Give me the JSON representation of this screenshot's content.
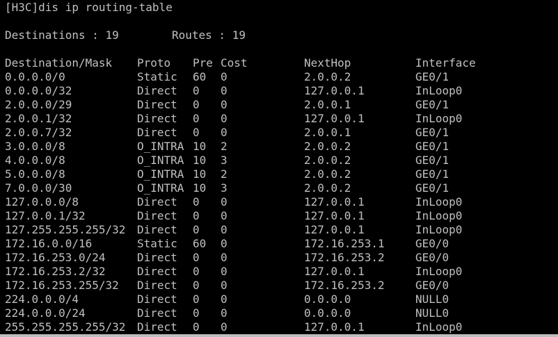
{
  "terminal": {
    "command_line": "[H3C]dis ip routing-table",
    "summary": {
      "destinations": "Destinations : 19",
      "routes": "Routes : 19"
    },
    "headers": {
      "destination": "Destination/Mask",
      "proto": "Proto",
      "pre": "Pre",
      "cost": "Cost",
      "nexthop": "NextHop",
      "interface": "Interface"
    },
    "rows": [
      {
        "dest": "0.0.0.0/0",
        "proto": "Static",
        "pre": "60",
        "cost": "0",
        "nexthop": "2.0.0.2",
        "iface": "GE0/1"
      },
      {
        "dest": "0.0.0.0/32",
        "proto": "Direct",
        "pre": "0",
        "cost": "0",
        "nexthop": "127.0.0.1",
        "iface": "InLoop0"
      },
      {
        "dest": "2.0.0.0/29",
        "proto": "Direct",
        "pre": "0",
        "cost": "0",
        "nexthop": "2.0.0.1",
        "iface": "GE0/1"
      },
      {
        "dest": "2.0.0.1/32",
        "proto": "Direct",
        "pre": "0",
        "cost": "0",
        "nexthop": "127.0.0.1",
        "iface": "InLoop0"
      },
      {
        "dest": "2.0.0.7/32",
        "proto": "Direct",
        "pre": "0",
        "cost": "0",
        "nexthop": "2.0.0.1",
        "iface": "GE0/1"
      },
      {
        "dest": "3.0.0.0/8",
        "proto": "O_INTRA",
        "pre": "10",
        "cost": "2",
        "nexthop": "2.0.0.2",
        "iface": "GE0/1"
      },
      {
        "dest": "4.0.0.0/8",
        "proto": "O_INTRA",
        "pre": "10",
        "cost": "3",
        "nexthop": "2.0.0.2",
        "iface": "GE0/1"
      },
      {
        "dest": "5.0.0.0/8",
        "proto": "O_INTRA",
        "pre": "10",
        "cost": "2",
        "nexthop": "2.0.0.2",
        "iface": "GE0/1"
      },
      {
        "dest": "7.0.0.0/30",
        "proto": "O_INTRA",
        "pre": "10",
        "cost": "3",
        "nexthop": "2.0.0.2",
        "iface": "GE0/1"
      },
      {
        "dest": "127.0.0.0/8",
        "proto": "Direct",
        "pre": "0",
        "cost": "0",
        "nexthop": "127.0.0.1",
        "iface": "InLoop0"
      },
      {
        "dest": "127.0.0.1/32",
        "proto": "Direct",
        "pre": "0",
        "cost": "0",
        "nexthop": "127.0.0.1",
        "iface": "InLoop0"
      },
      {
        "dest": "127.255.255.255/32",
        "proto": "Direct",
        "pre": "0",
        "cost": "0",
        "nexthop": "127.0.0.1",
        "iface": "InLoop0"
      },
      {
        "dest": "172.16.0.0/16",
        "proto": "Static",
        "pre": "60",
        "cost": "0",
        "nexthop": "172.16.253.1",
        "iface": "GE0/0"
      },
      {
        "dest": "172.16.253.0/24",
        "proto": "Direct",
        "pre": "0",
        "cost": "0",
        "nexthop": "172.16.253.2",
        "iface": "GE0/0"
      },
      {
        "dest": "172.16.253.2/32",
        "proto": "Direct",
        "pre": "0",
        "cost": "0",
        "nexthop": "127.0.0.1",
        "iface": "InLoop0"
      },
      {
        "dest": "172.16.253.255/32",
        "proto": "Direct",
        "pre": "0",
        "cost": "0",
        "nexthop": "172.16.253.2",
        "iface": "GE0/0"
      },
      {
        "dest": "224.0.0.0/4",
        "proto": "Direct",
        "pre": "0",
        "cost": "0",
        "nexthop": "0.0.0.0",
        "iface": "NULL0"
      },
      {
        "dest": "224.0.0.0/24",
        "proto": "Direct",
        "pre": "0",
        "cost": "0",
        "nexthop": "0.0.0.0",
        "iface": "NULL0"
      },
      {
        "dest": "255.255.255.255/32",
        "proto": "Direct",
        "pre": "0",
        "cost": "0",
        "nexthop": "127.0.0.1",
        "iface": "InLoop0"
      }
    ]
  },
  "colors": {
    "background": "#000000",
    "text": "#c0c0c0"
  }
}
